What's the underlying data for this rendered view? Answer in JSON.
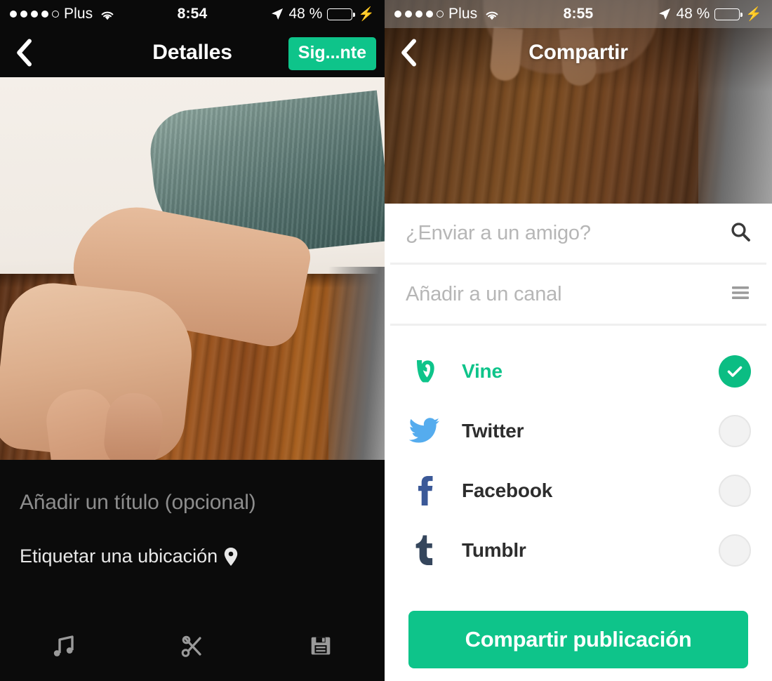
{
  "left_screen": {
    "status_bar": {
      "signal_dots_filled": 4,
      "signal_dots_total": 5,
      "carrier": "Plus",
      "wifi_icon": "wifi-icon",
      "time": "8:54",
      "location_icon": "location-arrow-icon",
      "battery_percent": "48 %",
      "battery_level": 48,
      "charging_icon": "lightning-bolt-icon"
    },
    "navbar": {
      "back_icon": "back-chevron-icon",
      "title": "Detalles",
      "next_label": "Sig...nte"
    },
    "media_preview": {
      "alt": "video-preview-frame"
    },
    "caption_placeholder": "Añadir un título (opcional)",
    "location_label": "Etiquetar una ubicación",
    "location_pin_icon": "map-pin-icon",
    "toolbar": [
      {
        "icon": "music-note-icon",
        "name": "music-tool"
      },
      {
        "icon": "scissors-icon",
        "name": "trim-tool"
      },
      {
        "icon": "floppy-disk-icon",
        "name": "save-tool"
      }
    ]
  },
  "right_screen": {
    "status_bar": {
      "signal_dots_filled": 4,
      "signal_dots_total": 5,
      "carrier": "Plus",
      "wifi_icon": "wifi-icon",
      "time": "8:55",
      "location_icon": "location-arrow-icon",
      "battery_percent": "48 %",
      "battery_level": 48,
      "charging_icon": "lightning-bolt-icon"
    },
    "navbar": {
      "back_icon": "back-chevron-icon",
      "title": "Compartir"
    },
    "media_preview": {
      "alt": "video-preview-frame"
    },
    "fields": [
      {
        "placeholder": "¿Enviar a un amigo?",
        "value": "",
        "trailing_icon": "search-icon",
        "name": "send-to-friend-field"
      },
      {
        "placeholder": "Añadir a un canal",
        "value": "",
        "trailing_icon": "hamburger-menu-icon",
        "name": "add-to-channel-field"
      }
    ],
    "networks": [
      {
        "label": "Vine",
        "icon": "vine-logo-icon",
        "selected": true,
        "color": "#0ec48a"
      },
      {
        "label": "Twitter",
        "icon": "twitter-bird-icon",
        "selected": false,
        "color": "#55acee"
      },
      {
        "label": "Facebook",
        "icon": "facebook-f-icon",
        "selected": false,
        "color": "#3b5998"
      },
      {
        "label": "Tumblr",
        "icon": "tumblr-t-icon",
        "selected": false,
        "color": "#35465c"
      }
    ],
    "share_button_label": "Compartir publicación"
  },
  "colors": {
    "accent_green": "#0ec48a",
    "toggle_on": "#0bbd83",
    "toggle_off": "#f2f2f2",
    "dark_bg": "#0b0b0b",
    "divider": "#efefef",
    "placeholder_text": "#b6b6b6"
  }
}
